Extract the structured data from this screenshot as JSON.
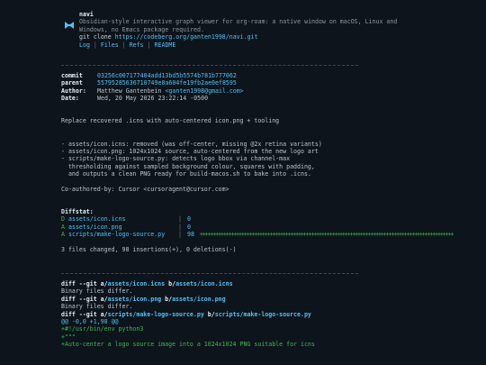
{
  "repo": {
    "name": "navi",
    "description_line1": "Obsidian-style interactive graph viewer for org-roam: a native window on macOS, Linux and",
    "description_line2": "Windows, no Emacs package required.",
    "clone_prefix": "git clone ",
    "clone_url": "https://codeberg.org/ganten1998/navi.git",
    "nav": [
      "Log",
      "Files",
      "Refs",
      "README"
    ],
    "nav_separator": "|",
    "logo_icon": "bowtie-logo-icon"
  },
  "commit": {
    "commit_label": "commit",
    "commit_hash": "03256c007177404add13bd5b5574b781b777062",
    "parent_label": "parent",
    "parent_hash": "55795285636710749e0a604fe19fb2ae0ef8595",
    "author_label": "Author:",
    "author_name": "Matthew Gantenbein ",
    "author_email": "<ganten1998@gmail.com>",
    "date_label": "Date:",
    "date_value": "Wed, 20 May 2026 23:22:14 -0500",
    "subject": "Replace recovered .icns with auto-centered icon.png + tooling",
    "body": [
      "- assets/icon.icns: removed (was off-center, missing @2x retina variants)",
      "- assets/icon.png: 1024x1024 source, auto-centered from the new logo art",
      "- scripts/make-logo-source.py: detects logo bbox via channel-max",
      "  thresholding against sampled background colour, squares with padding,",
      "  and outputs a clean PNG ready for build-macos.sh to bake into .icns."
    ],
    "coauthor": "Co-authored-by: Cursor <cursoragent@cursor.com>"
  },
  "diffstat": {
    "label": "Diffstat:",
    "rows": [
      {
        "flag": "D",
        "file": "assets/icon.icns",
        "sep": "|",
        "num": "0",
        "bar": ""
      },
      {
        "flag": "A",
        "file": "assets/icon.png",
        "sep": "|",
        "num": "0",
        "bar": ""
      },
      {
        "flag": "A",
        "file": "scripts/make-logo-source.py",
        "sep": "|",
        "num": "98",
        "bar": "++++++++++++++++++++++++++++++++++++++++++++++++++++++++++++++++++++++++++++++++++++++++++++++++++"
      }
    ],
    "summary": "3 files changed, 98 insertions(+), 0 deletions(-)"
  },
  "diffs": [
    {
      "prefix": "diff --git a/",
      "a": "assets/icon.icns",
      "mid": " b/",
      "b": "assets/icon.icns",
      "note": "Binary files differ."
    },
    {
      "prefix": "diff --git a/",
      "a": "assets/icon.png",
      "mid": " b/",
      "b": "assets/icon.png",
      "note": "Binary files differ."
    },
    {
      "prefix": "diff --git a/",
      "a": "scripts/make-logo-source.py",
      "mid": " b/",
      "b": "scripts/make-logo-source.py",
      "note": ""
    }
  ],
  "hunk": "@@ -0,0 +1,98 @@",
  "added_lines": [
    "+#!/usr/bin/env python3",
    "+\"\"\"",
    "+Auto-center a logo source image into a 1024x1024 PNG suitable for icns"
  ],
  "colors": {
    "background": "#0e141b",
    "link": "#4fc3f7",
    "add": "#3fb950",
    "text": "#b9c4cd"
  }
}
